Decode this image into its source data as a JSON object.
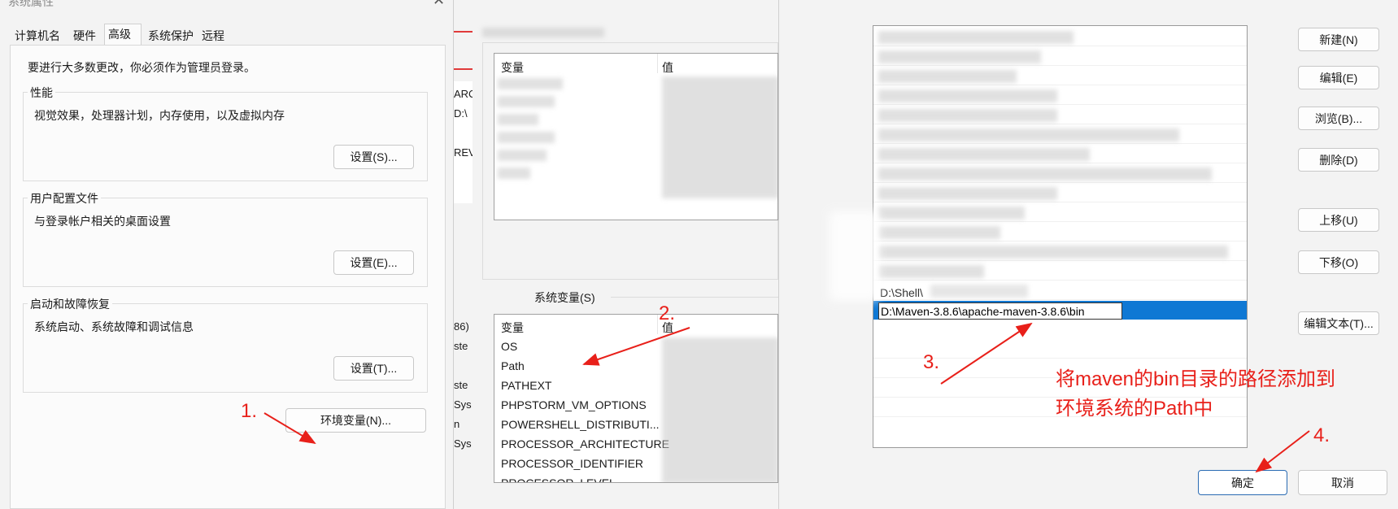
{
  "left_dialog": {
    "title": "系统属性",
    "tabs": [
      "计算机名",
      "硬件",
      "高级",
      "系统保护",
      "远程"
    ],
    "admin_note": "要进行大多数更改，你必须作为管理员登录。",
    "performance": {
      "title": "性能",
      "desc": "视觉效果，处理器计划，内存使用，以及虚拟内存",
      "button": "设置(S)..."
    },
    "user_profile": {
      "title": "用户配置文件",
      "desc": "与登录帐户相关的桌面设置",
      "button": "设置(E)..."
    },
    "startup": {
      "title": "启动和故障恢复",
      "desc": "系统启动、系统故障和调试信息",
      "button": "设置(T)..."
    },
    "env_button": "环境变量(N)..."
  },
  "middle_strip": {
    "texts": [
      "ARC",
      "D:\\",
      "REV",
      "86)",
      "ste",
      "ste",
      "Sys",
      "n",
      "Sys"
    ]
  },
  "middle_dialog": {
    "user_vars_header": {
      "col1": "变量",
      "col2": "值"
    },
    "system_vars_label": "系统变量(S)",
    "system_vars_header": {
      "col1": "变量",
      "col2": "值"
    },
    "system_vars": [
      "OS",
      "Path",
      "PATHEXT",
      "PHPSTORM_VM_OPTIONS",
      "POWERSHELL_DISTRIBUTI...",
      "PROCESSOR_ARCHITECTURE",
      "PROCESSOR_IDENTIFIER",
      "PROCESSOR_LEVEL"
    ]
  },
  "right_dialog": {
    "partial_entry": "D:\\Shell\\",
    "edit_entry": "D:\\Maven-3.8.6\\apache-maven-3.8.6\\bin",
    "buttons": {
      "new": "新建(N)",
      "edit": "编辑(E)",
      "browse": "浏览(B)...",
      "delete": "删除(D)",
      "move_up": "上移(U)",
      "move_down": "下移(O)",
      "edit_text": "编辑文本(T)...",
      "ok": "确定",
      "cancel": "取消"
    }
  },
  "annotations": {
    "step1": "1.",
    "step2": "2.",
    "step3": "3.",
    "step4": "4.",
    "note_line1": "将maven的bin目录的路径添加到",
    "note_line2": "环境系统的Path中",
    "color": "#e8201a"
  }
}
